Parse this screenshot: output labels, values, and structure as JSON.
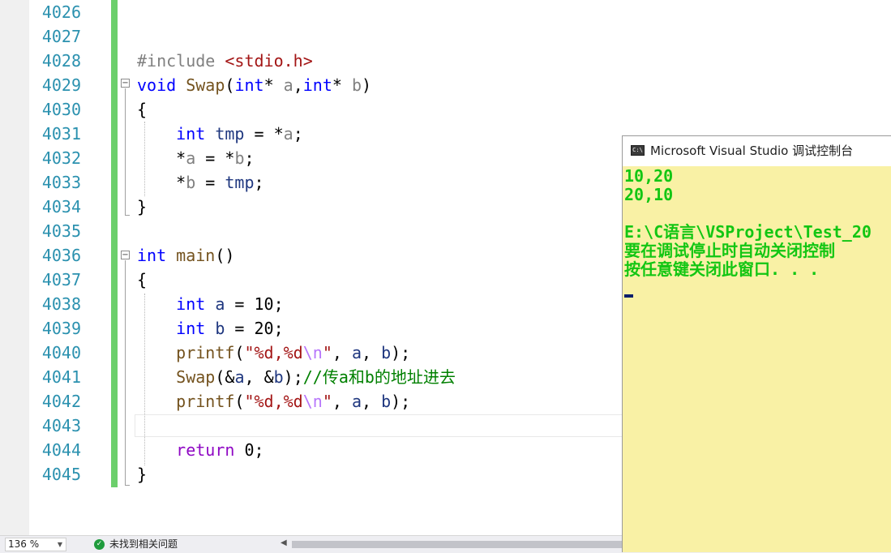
{
  "editor": {
    "lines": [
      {
        "num": "4026",
        "tokens": []
      },
      {
        "num": "4027",
        "tokens": []
      },
      {
        "num": "4028",
        "tokens": [
          {
            "t": "#include ",
            "c": "inc"
          },
          {
            "t": "<stdio.h>",
            "c": "str"
          }
        ]
      },
      {
        "num": "4029",
        "tokens": [
          {
            "t": "void",
            "c": "kw"
          },
          {
            "t": " ",
            "c": ""
          },
          {
            "t": "Swap",
            "c": "fn"
          },
          {
            "t": "(",
            "c": ""
          },
          {
            "t": "int",
            "c": "kw"
          },
          {
            "t": "* ",
            "c": ""
          },
          {
            "t": "a",
            "c": "prm"
          },
          {
            "t": ",",
            "c": ""
          },
          {
            "t": "int",
            "c": "kw"
          },
          {
            "t": "* ",
            "c": ""
          },
          {
            "t": "b",
            "c": "prm"
          },
          {
            "t": ")",
            "c": ""
          }
        ]
      },
      {
        "num": "4030",
        "tokens": [
          {
            "t": "{",
            "c": ""
          }
        ]
      },
      {
        "num": "4031",
        "tokens": [
          {
            "t": "    ",
            "c": ""
          },
          {
            "t": "int",
            "c": "kw"
          },
          {
            "t": " ",
            "c": ""
          },
          {
            "t": "tmp",
            "c": "var"
          },
          {
            "t": " = *",
            "c": ""
          },
          {
            "t": "a",
            "c": "prm"
          },
          {
            "t": ";",
            "c": ""
          }
        ]
      },
      {
        "num": "4032",
        "tokens": [
          {
            "t": "    *",
            "c": ""
          },
          {
            "t": "a",
            "c": "prm"
          },
          {
            "t": " = *",
            "c": ""
          },
          {
            "t": "b",
            "c": "prm"
          },
          {
            "t": ";",
            "c": ""
          }
        ]
      },
      {
        "num": "4033",
        "tokens": [
          {
            "t": "    *",
            "c": ""
          },
          {
            "t": "b",
            "c": "prm"
          },
          {
            "t": " = ",
            "c": ""
          },
          {
            "t": "tmp",
            "c": "var"
          },
          {
            "t": ";",
            "c": ""
          }
        ]
      },
      {
        "num": "4034",
        "tokens": [
          {
            "t": "}",
            "c": ""
          }
        ]
      },
      {
        "num": "4035",
        "tokens": []
      },
      {
        "num": "4036",
        "tokens": [
          {
            "t": "int",
            "c": "kw"
          },
          {
            "t": " ",
            "c": ""
          },
          {
            "t": "main",
            "c": "fn"
          },
          {
            "t": "()",
            "c": ""
          }
        ]
      },
      {
        "num": "4037",
        "tokens": [
          {
            "t": "{",
            "c": ""
          }
        ]
      },
      {
        "num": "4038",
        "tokens": [
          {
            "t": "    ",
            "c": ""
          },
          {
            "t": "int",
            "c": "kw"
          },
          {
            "t": " ",
            "c": ""
          },
          {
            "t": "a",
            "c": "var"
          },
          {
            "t": " = 10;",
            "c": ""
          }
        ]
      },
      {
        "num": "4039",
        "tokens": [
          {
            "t": "    ",
            "c": ""
          },
          {
            "t": "int",
            "c": "kw"
          },
          {
            "t": " ",
            "c": ""
          },
          {
            "t": "b",
            "c": "var"
          },
          {
            "t": " = 20;",
            "c": ""
          }
        ]
      },
      {
        "num": "4040",
        "tokens": [
          {
            "t": "    ",
            "c": ""
          },
          {
            "t": "printf",
            "c": "fn"
          },
          {
            "t": "(",
            "c": ""
          },
          {
            "t": "\"%d,%d",
            "c": "str"
          },
          {
            "t": "\\n",
            "c": "esc"
          },
          {
            "t": "\"",
            "c": "str"
          },
          {
            "t": ", ",
            "c": ""
          },
          {
            "t": "a",
            "c": "var"
          },
          {
            "t": ", ",
            "c": ""
          },
          {
            "t": "b",
            "c": "var"
          },
          {
            "t": ");",
            "c": ""
          }
        ]
      },
      {
        "num": "4041",
        "tokens": [
          {
            "t": "    ",
            "c": ""
          },
          {
            "t": "Swap",
            "c": "fn"
          },
          {
            "t": "(&",
            "c": ""
          },
          {
            "t": "a",
            "c": "var"
          },
          {
            "t": ", &",
            "c": ""
          },
          {
            "t": "b",
            "c": "var"
          },
          {
            "t": ");",
            "c": ""
          },
          {
            "t": "//传a和b的地址进去",
            "c": "cmt"
          }
        ]
      },
      {
        "num": "4042",
        "tokens": [
          {
            "t": "    ",
            "c": ""
          },
          {
            "t": "printf",
            "c": "fn"
          },
          {
            "t": "(",
            "c": ""
          },
          {
            "t": "\"%d,%d",
            "c": "str"
          },
          {
            "t": "\\n",
            "c": "esc"
          },
          {
            "t": "\"",
            "c": "str"
          },
          {
            "t": ", ",
            "c": ""
          },
          {
            "t": "a",
            "c": "var"
          },
          {
            "t": ", ",
            "c": ""
          },
          {
            "t": "b",
            "c": "var"
          },
          {
            "t": ");",
            "c": ""
          }
        ]
      },
      {
        "num": "4043",
        "tokens": []
      },
      {
        "num": "4044",
        "tokens": [
          {
            "t": "    ",
            "c": ""
          },
          {
            "t": "return",
            "c": "ctl"
          },
          {
            "t": " 0;",
            "c": ""
          }
        ]
      },
      {
        "num": "4045",
        "tokens": [
          {
            "t": "}",
            "c": ""
          }
        ]
      }
    ],
    "fold_collapse_glyph": "−"
  },
  "status_bar": {
    "zoom": "136 %",
    "zoom_caret": "▼",
    "issues_icon_glyph": "✓",
    "issues_text": "未找到相关问题",
    "scroll_left_glyph": "◀"
  },
  "console": {
    "icon_glyph": "C:\\",
    "title": "Microsoft Visual Studio 调试控制台",
    "lines": [
      "10,20",
      "20,10",
      "",
      "E:\\C语言\\VSProject\\Test_20",
      "要在调试停止时自动关闭控制",
      "按任意键关闭此窗口. . ."
    ]
  },
  "colors": {
    "line_numbers": "#2b91af",
    "keyword": "#0000ff",
    "function": "#74531f",
    "string": "#a31515",
    "comment": "#008000",
    "change_bar": "#6ccf6c",
    "console_bg": "#f9f1a5",
    "console_text": "#13c613"
  }
}
